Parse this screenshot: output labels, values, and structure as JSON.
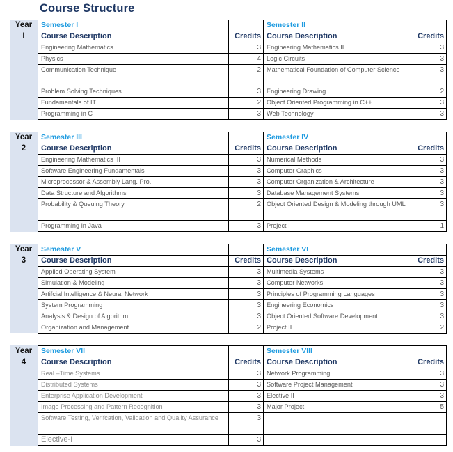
{
  "title": "Course Structure",
  "labels": {
    "year": "Year",
    "course_description": "Course Description",
    "credits": "Credits"
  },
  "years": [
    {
      "year_number": "I",
      "semesters": [
        "Semester I",
        "Semester II"
      ],
      "rows": [
        {
          "c1": "Engineering Mathematics I",
          "k1": "3",
          "c2": "Engineering Mathematics II",
          "k2": "3"
        },
        {
          "c1": "Physics",
          "k1": "4",
          "c2": "Logic Circuits",
          "k2": "3"
        },
        {
          "c1": "Communication Technique",
          "k1": "2",
          "c2": "Mathematical Foundation of Computer Science",
          "k2": "3"
        },
        {
          "c1": "Problem Solving Techniques",
          "k1": "3",
          "c2": "Engineering Drawing",
          "k2": "2"
        },
        {
          "c1": "Fundamentals of IT",
          "k1": "2",
          "c2": "Object Oriented Programming in C++",
          "k2": "3"
        },
        {
          "c1": "Programming in C",
          "k1": "3",
          "c2": "Web Technology",
          "k2": "3"
        }
      ]
    },
    {
      "year_number": "2",
      "semesters": [
        "Semester III",
        "Semester IV"
      ],
      "rows": [
        {
          "c1": "Engineering Mathematics III",
          "k1": "3",
          "c2": "Numerical Methods",
          "k2": "3"
        },
        {
          "c1": "Software Engineering Fundamentals",
          "k1": "3",
          "c2": "Computer Graphics",
          "k2": "3"
        },
        {
          "c1": "Microprocessor & Assembly Lang. Pro.",
          "k1": "3",
          "c2": "Computer Organization & Architecture",
          "k2": "3"
        },
        {
          "c1": "Data Structure and Algorithms",
          "k1": "3",
          "c2": "Database Management Systems",
          "k2": "3"
        },
        {
          "c1": "Probability & Queuing Theory",
          "k1": "2",
          "c2": "Object Oriented Design & Modeling through UML",
          "k2": "3"
        },
        {
          "c1": "Programming in Java",
          "k1": "3",
          "c2": "Project I",
          "k2": "1"
        }
      ]
    },
    {
      "year_number": "3",
      "semesters": [
        "Semester V",
        "Semester VI"
      ],
      "rows": [
        {
          "c1": "Applied Operating System",
          "k1": "3",
          "c2": "Multimedia Systems",
          "k2": "3"
        },
        {
          "c1": "Simulation & Modeling",
          "k1": "3",
          "c2": "Computer Networks",
          "k2": "3"
        },
        {
          "c1": "Artifcial Intelligence & Neural Network",
          "k1": "3",
          "c2": "Principles of Programming Languages",
          "k2": "3"
        },
        {
          "c1": "System Programming",
          "k1": "3",
          "c2": "Engineering Economics",
          "k2": "3"
        },
        {
          "c1": "Analysis & Design of Algorithm",
          "k1": "3",
          "c2": "Object Oriented Software Development",
          "k2": "3"
        },
        {
          "c1": "Organization and Management",
          "k1": "2",
          "c2": "Project II",
          "k2": "2"
        }
      ]
    },
    {
      "year_number": "4",
      "semesters": [
        "Semester VII",
        "Semester VIII"
      ],
      "rows": [
        {
          "c1": "Real –Time Systems",
          "k1": "3",
          "c2": "Network Programming",
          "k2": "3"
        },
        {
          "c1": "Distributed Systems",
          "k1": "3",
          "c2": "Software Project Management",
          "k2": "3"
        },
        {
          "c1": "Enterprise Application Development",
          "k1": "3",
          "c2": "Elective II",
          "k2": "3"
        },
        {
          "c1": "Image Processing and Pattern Recognition",
          "k1": "3",
          "c2": "Major Project",
          "k2": "5"
        },
        {
          "c1": "Software Testing, Verifcation, Validation and Quality Assurance",
          "k1": "3",
          "c2": "",
          "k2": ""
        },
        {
          "c1": "Elective-I",
          "k1": "3",
          "c2": "",
          "k2": ""
        }
      ]
    }
  ]
}
